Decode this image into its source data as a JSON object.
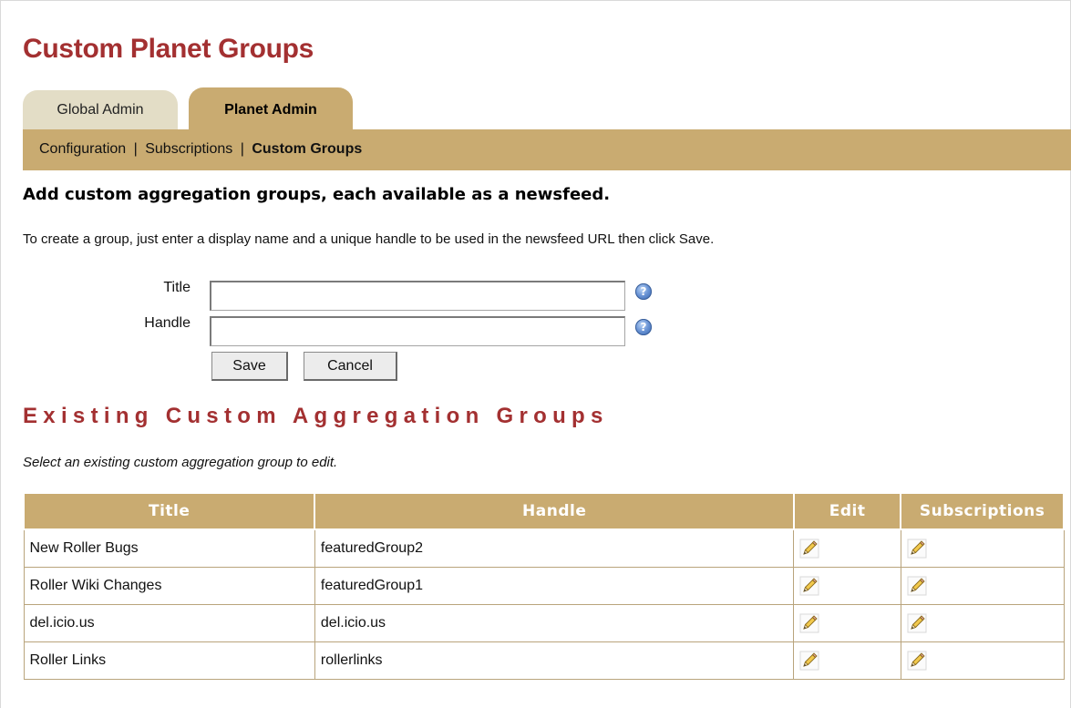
{
  "page": {
    "title": "Custom Planet Groups"
  },
  "tabs": [
    {
      "label": "Global Admin",
      "active": false
    },
    {
      "label": "Planet Admin",
      "active": true
    }
  ],
  "subnav": {
    "items": [
      {
        "label": "Configuration",
        "current": false
      },
      {
        "label": "Subscriptions",
        "current": false
      },
      {
        "label": "Custom Groups",
        "current": true
      }
    ],
    "separator": "|"
  },
  "add_section": {
    "heading": "Add custom aggregation groups, each available as a newsfeed.",
    "instructions": "To create a group, just enter a display name and a unique handle to be used in the newsfeed URL then click Save.",
    "title_label": "Title",
    "title_value": "",
    "handle_label": "Handle",
    "handle_value": "",
    "save_label": "Save",
    "cancel_label": "Cancel",
    "help_glyph": "?"
  },
  "existing_section": {
    "heading": "Existing Custom Aggregation Groups",
    "hint": "Select an existing custom aggregation group to edit."
  },
  "table": {
    "columns": [
      "Title",
      "Handle",
      "Edit",
      "Subscriptions"
    ],
    "rows": [
      {
        "title": "New Roller Bugs",
        "handle": "featuredGroup2"
      },
      {
        "title": "Roller Wiki Changes",
        "handle": "featuredGroup1"
      },
      {
        "title": "del.icio.us",
        "handle": "del.icio.us"
      },
      {
        "title": "Roller Links",
        "handle": "rollerlinks"
      }
    ]
  },
  "colors": {
    "title_red": "#a33031",
    "tan": "#c9ab71",
    "tab_inactive": "#e3ddc6",
    "help_blue": "#2f5ea8"
  },
  "icons": {
    "help": "help-icon",
    "edit": "pencil-icon"
  }
}
